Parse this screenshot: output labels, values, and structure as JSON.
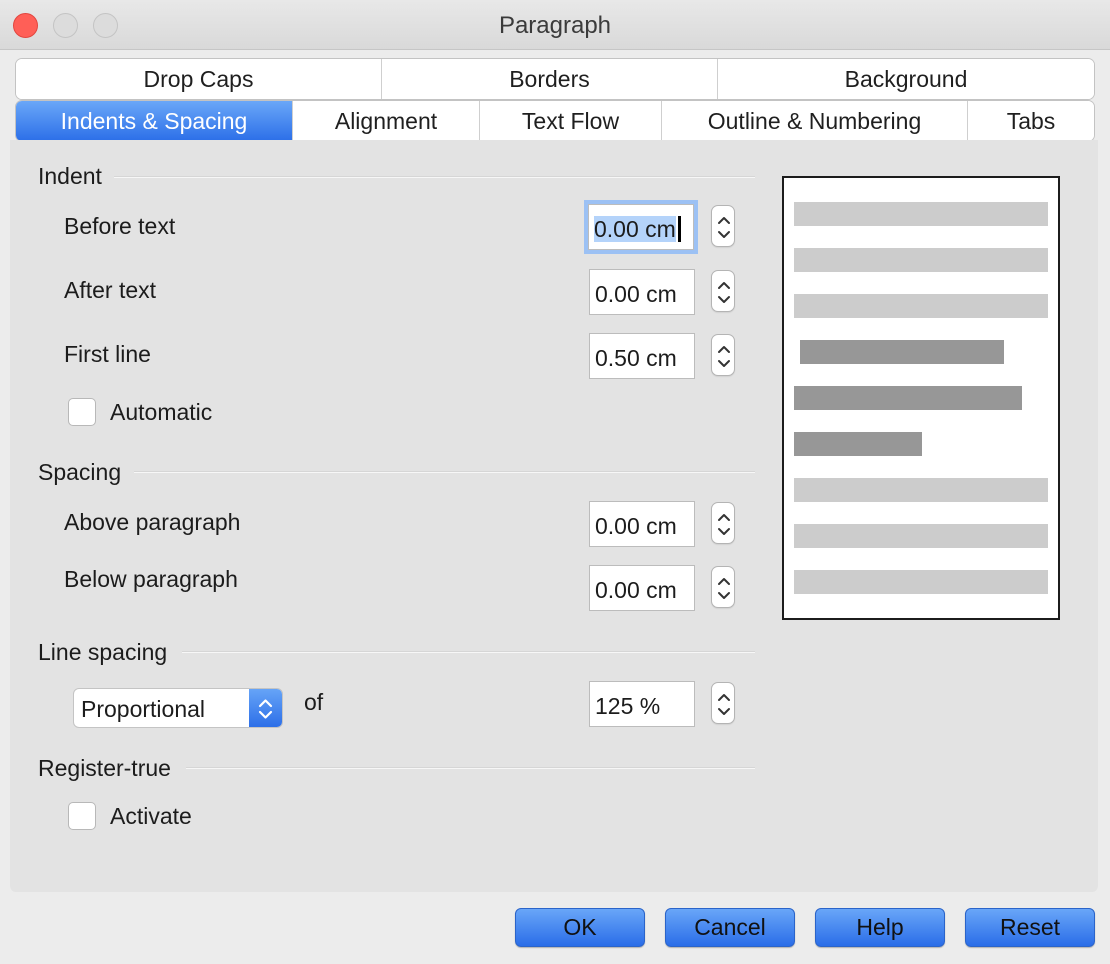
{
  "window": {
    "title": "Paragraph"
  },
  "tabs": {
    "row1": [
      {
        "label": "Drop Caps"
      },
      {
        "label": "Borders"
      },
      {
        "label": "Background"
      }
    ],
    "row2": [
      {
        "label": "Indents & Spacing",
        "active": true
      },
      {
        "label": "Alignment"
      },
      {
        "label": "Text Flow"
      },
      {
        "label": "Outline & Numbering"
      },
      {
        "label": "Tabs"
      }
    ]
  },
  "indent": {
    "title": "Indent",
    "before_label": "Before text",
    "before_value": "0.00 cm",
    "after_label": "After text",
    "after_value": "0.00 cm",
    "first_label": "First line",
    "first_value": "0.50 cm",
    "automatic_label": "Automatic",
    "automatic_checked": false
  },
  "spacing": {
    "title": "Spacing",
    "above_label": "Above paragraph",
    "above_value": "0.00 cm",
    "below_label": "Below paragraph",
    "below_value": "0.00 cm"
  },
  "line_spacing": {
    "title": "Line spacing",
    "mode": "Proportional",
    "of_label": "of",
    "value": "125 %"
  },
  "register_true": {
    "title": "Register-true",
    "activate_label": "Activate",
    "activate_checked": false
  },
  "buttons": {
    "ok": "OK",
    "cancel": "Cancel",
    "help": "Help",
    "reset": "Reset"
  },
  "colors": {
    "accent": "#2c6fe8",
    "close": "#ff5f57",
    "preview_light": "#cccccc",
    "preview_dark": "#979797"
  }
}
